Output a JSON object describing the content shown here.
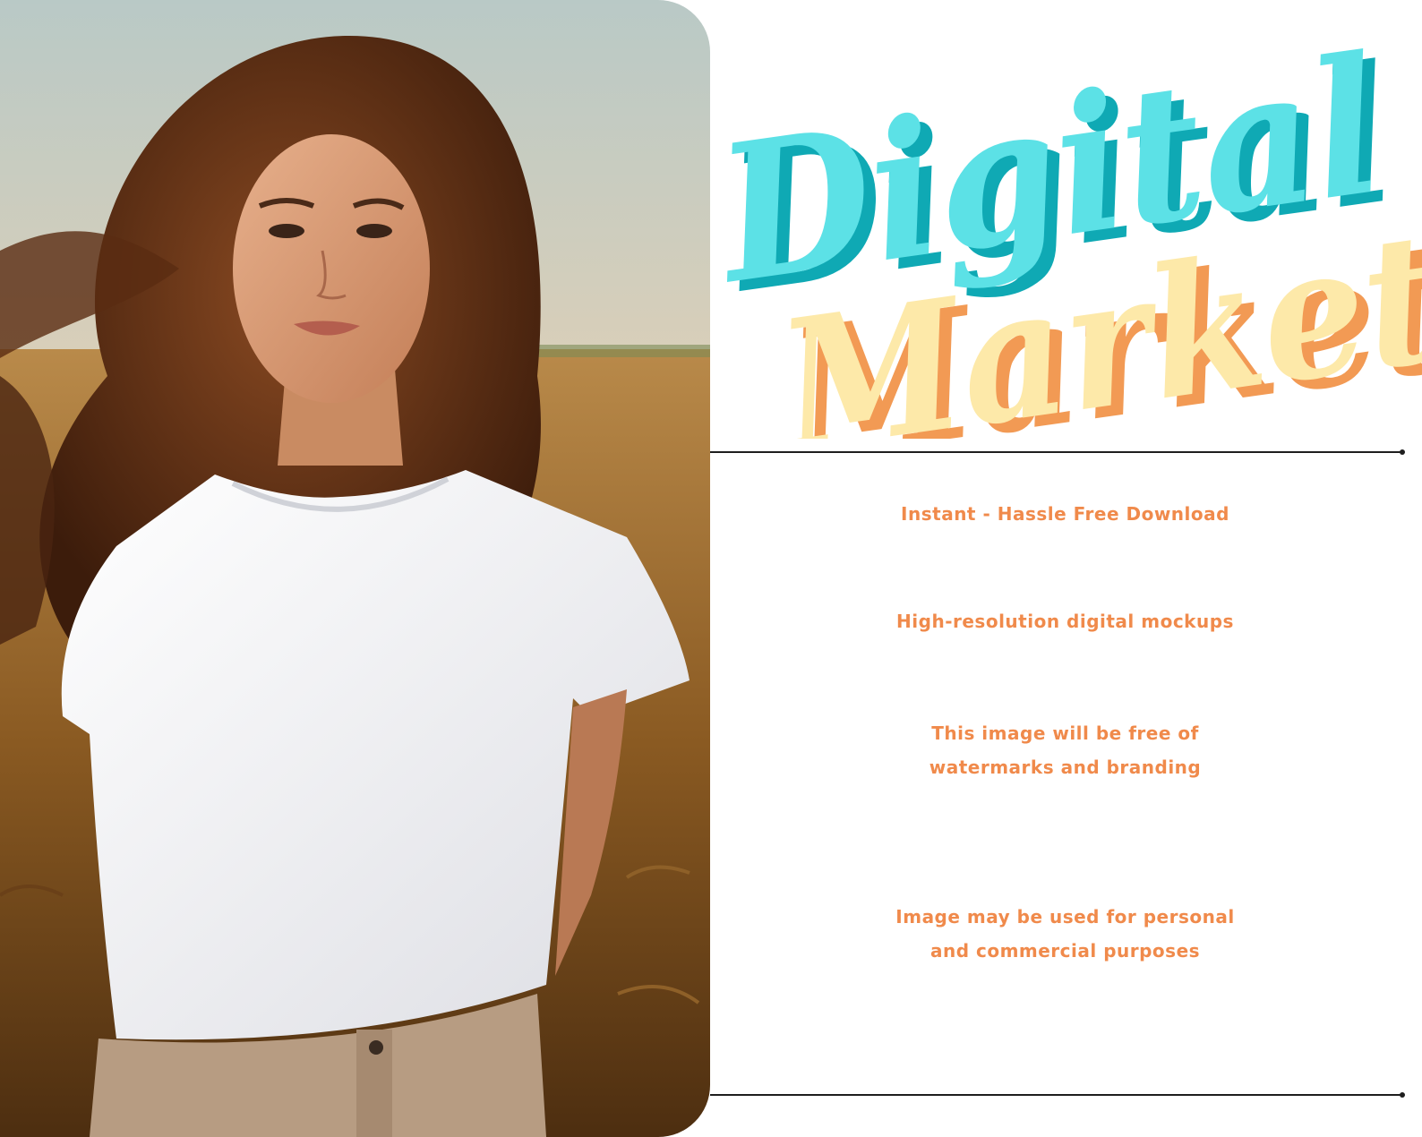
{
  "logo": {
    "word1": "Digital",
    "word2": "Market",
    "colors": {
      "word1_fill": "#5ce1e6",
      "word1_shadow": "#0fa9b4",
      "word2_fill": "#fde9a9",
      "word2_shadow": "#f29a54"
    }
  },
  "features": {
    "download": "Instant - Hassle Free Download",
    "resolution": "High-resolution digital mockups",
    "watermark_line1": "This image will be free of",
    "watermark_line2": "watermarks and branding",
    "usage_line1": "Image may be used  for personal",
    "usage_line2": "and commercial purposes"
  },
  "colors": {
    "feature_text": "#f08a4b",
    "divider": "#1e1e1e",
    "background": "#ffffff"
  },
  "photo": {
    "subject": "woman-in-white-tshirt-in-wheat-field"
  }
}
